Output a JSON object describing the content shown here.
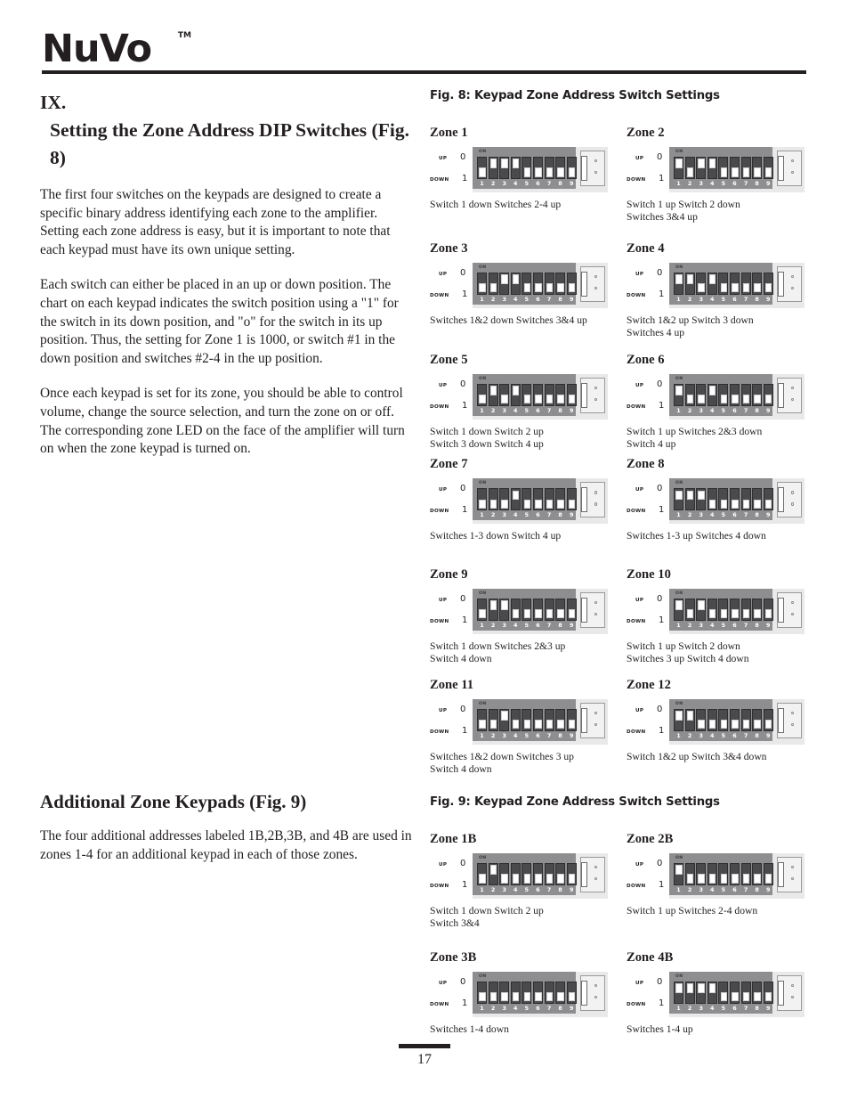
{
  "brand": {
    "name": "NuVo",
    "tm": "TM"
  },
  "left": {
    "section_number": "IX.",
    "section_title": "Setting the Zone Address DIP Switches (Fig. 8)",
    "paragraphs": [
      "The first four switches on the keypads are designed to create a specific binary address identifying each zone to the amplifier.  Setting each zone address is easy, but it is important to note that each keypad must have its own unique setting.",
      "Each switch can either be placed in an up or down position. The chart on each keypad indicates the switch position using a \"1\" for the switch in its down position, and \"o\" for the switch in its up position. Thus, the setting for Zone 1 is 1000, or switch #1 in the down position and switches #2-4 in the up position.",
      "Once each keypad is set for its zone, you should be able to control volume, change the source selection, and turn the zone on or off. The corresponding zone LED on the face of the amplifier will turn on when the zone keypad is turned on."
    ],
    "additional_title": "Additional Zone Keypads (Fig. 9)",
    "additional_paragraph": "The four additional addresses labeled 1B,2B,3B, and 4B are used in zones 1-4 for an additional keypad in each of those zones."
  },
  "dip_legend": {
    "up": "UP",
    "down": "DOWN",
    "up_value": "0",
    "down_value": "1",
    "on": "ON",
    "numbers": [
      "1",
      "2",
      "3",
      "4",
      "5",
      "6",
      "7",
      "8",
      "9"
    ]
  },
  "fig8": {
    "heading": "Fig. 8: Keypad Zone Address Switch Settings",
    "zones": [
      {
        "label": "Zone 1",
        "switches": [
          "down",
          "up",
          "up",
          "up",
          "down",
          "down",
          "down",
          "down",
          "down"
        ],
        "caption": "Switch 1 down  Switches 2-4 up"
      },
      {
        "label": "Zone 2",
        "switches": [
          "up",
          "down",
          "up",
          "up",
          "down",
          "down",
          "down",
          "down",
          "down"
        ],
        "caption": "Switch 1 up  Switch 2 down\nSwitches 3&4 up"
      },
      {
        "label": "Zone 3",
        "switches": [
          "down",
          "down",
          "up",
          "up",
          "down",
          "down",
          "down",
          "down",
          "down"
        ],
        "caption": "Switches 1&2 down  Switches 3&4 up"
      },
      {
        "label": "Zone 4",
        "switches": [
          "up",
          "up",
          "down",
          "up",
          "down",
          "down",
          "down",
          "down",
          "down"
        ],
        "caption": "Switch 1&2 up  Switch 3 down\nSwitches 4 up"
      },
      {
        "label": "Zone 5",
        "switches": [
          "down",
          "up",
          "down",
          "up",
          "down",
          "down",
          "down",
          "down",
          "down"
        ],
        "caption": "Switch 1 down  Switch 2 up\nSwitch 3 down  Switch 4 up"
      },
      {
        "label": "Zone 6",
        "switches": [
          "up",
          "down",
          "down",
          "up",
          "down",
          "down",
          "down",
          "down",
          "down"
        ],
        "caption": "Switch 1 up  Switches 2&3 down\nSwitch 4 up"
      },
      {
        "label": "Zone 7",
        "switches": [
          "down",
          "down",
          "down",
          "up",
          "down",
          "down",
          "down",
          "down",
          "down"
        ],
        "caption": "Switches 1-3 down  Switch 4 up"
      },
      {
        "label": "Zone 8",
        "switches": [
          "up",
          "up",
          "up",
          "down",
          "down",
          "down",
          "down",
          "down",
          "down"
        ],
        "caption": "Switches 1-3 up  Switches 4 down"
      },
      {
        "label": "Zone 9",
        "switches": [
          "down",
          "up",
          "up",
          "down",
          "down",
          "down",
          "down",
          "down",
          "down"
        ],
        "caption": "Switch 1 down  Switches 2&3 up\nSwitch 4 down"
      },
      {
        "label": "Zone 10",
        "switches": [
          "up",
          "down",
          "up",
          "down",
          "down",
          "down",
          "down",
          "down",
          "down"
        ],
        "caption": "Switch 1 up  Switch 2 down\nSwitches 3 up Switch 4 down"
      },
      {
        "label": "Zone 11",
        "switches": [
          "down",
          "down",
          "up",
          "down",
          "down",
          "down",
          "down",
          "down",
          "down"
        ],
        "caption": "Switches 1&2 down  Switches 3 up\nSwitch 4 down"
      },
      {
        "label": "Zone 12",
        "switches": [
          "up",
          "up",
          "down",
          "down",
          "down",
          "down",
          "down",
          "down",
          "down"
        ],
        "caption": "Switch 1&2 up  Switch 3&4 down"
      }
    ]
  },
  "fig9": {
    "heading": "Fig. 9: Keypad Zone Address Switch Settings",
    "zones": [
      {
        "label": "Zone 1B",
        "switches": [
          "down",
          "up",
          "down",
          "down",
          "down",
          "down",
          "down",
          "down",
          "down"
        ],
        "caption": "Switch 1 down  Switch 2 up\nSwitch 3&4"
      },
      {
        "label": "Zone 2B",
        "switches": [
          "up",
          "down",
          "down",
          "down",
          "down",
          "down",
          "down",
          "down",
          "down"
        ],
        "caption": "Switch 1 up  Switches 2-4 down"
      },
      {
        "label": "Zone 3B",
        "switches": [
          "down",
          "down",
          "down",
          "down",
          "down",
          "down",
          "down",
          "down",
          "down"
        ],
        "caption": "Switches 1-4 down"
      },
      {
        "label": "Zone 4B",
        "switches": [
          "up",
          "up",
          "up",
          "up",
          "down",
          "down",
          "down",
          "down",
          "down"
        ],
        "caption": "Switches 1-4 up"
      }
    ]
  },
  "footer": {
    "page_number": "17"
  }
}
